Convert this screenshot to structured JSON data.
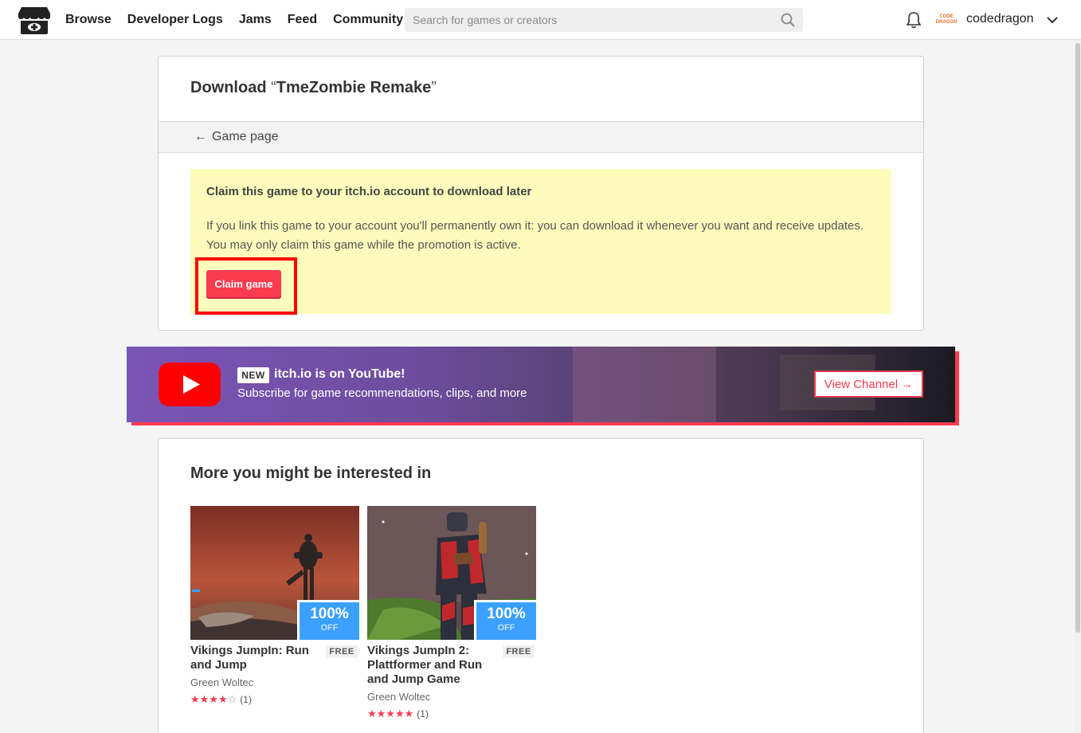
{
  "header": {
    "nav": [
      "Browse",
      "Developer Logs",
      "Jams",
      "Feed",
      "Community"
    ],
    "search_placeholder": "Search for games or creators",
    "username": "codedragon",
    "avatar_text_line1": "CODE",
    "avatar_text_line2": "DRAGON"
  },
  "download": {
    "title_prefix": "Download ",
    "open_quote": "“",
    "game_name": "TmeZombie Remake",
    "close_quote": "”",
    "back_arrow": "←",
    "game_page_link": "Game page",
    "claim_title": "Claim this game to your itch.io account to download later",
    "claim_desc": "If you link this game to your account you'll permanently own it: you can download it whenever you want and receive updates. You may only claim this game while the promotion is active.",
    "claim_button": "Claim game"
  },
  "youtube": {
    "new_badge": "NEW",
    "headline": "itch.io is on YouTube!",
    "subtitle": "Subscribe for game recommendations, clips, and more",
    "button": "View Channel →"
  },
  "more": {
    "title": "More you might be interested in",
    "games": [
      {
        "title": "Vikings JumpIn: Run and Jump",
        "author": "Green Woltec",
        "price": "FREE",
        "sale_pct": "100%",
        "sale_label": "OFF",
        "stars": "★★★★",
        "stars_empty": "☆",
        "rating_count": "(1)"
      },
      {
        "title": "Vikings JumpIn 2: Plattformer and Run and Jump Game",
        "author": "Green Woltec",
        "price": "FREE",
        "sale_pct": "100%",
        "sale_label": "OFF",
        "stars": "★★★★★",
        "stars_empty": "",
        "rating_count": "(1)"
      }
    ]
  },
  "colors": {
    "accent": "#fa3b50",
    "sale_blue": "#3ba0ff",
    "claim_bg": "#fdfcbc",
    "highlight": "#ff0000"
  }
}
